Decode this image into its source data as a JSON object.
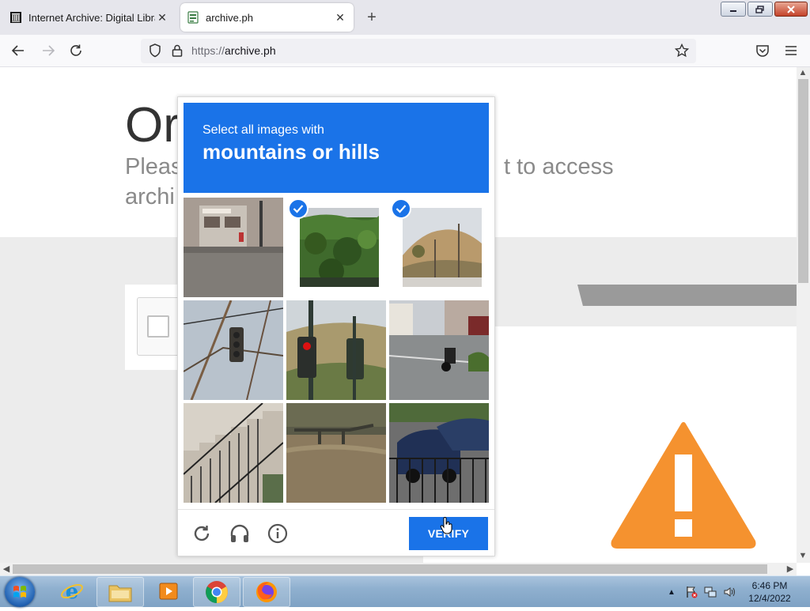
{
  "browser": {
    "tabs": [
      {
        "title": "Internet Archive: Digital Library",
        "active": false
      },
      {
        "title": "archive.ph",
        "active": true
      }
    ],
    "url_protocol": "https://",
    "url_host": "archive.ph"
  },
  "page": {
    "heading_partial": "Or",
    "subtitle_part1": "Pleas",
    "subtitle_part2": "t to access",
    "subtitle_part3": "archi"
  },
  "captcha": {
    "prompt_line1": "Select all images with",
    "prompt_line2": "mountains or hills",
    "tiles": [
      {
        "selected": false,
        "icon": "street-storefront"
      },
      {
        "selected": true,
        "icon": "green-hillside"
      },
      {
        "selected": true,
        "icon": "dry-hill-with-poles"
      },
      {
        "selected": false,
        "icon": "traffic-light-wires"
      },
      {
        "selected": false,
        "icon": "traffic-light-hills"
      },
      {
        "selected": false,
        "icon": "motorcycle-street"
      },
      {
        "selected": false,
        "icon": "staircase-railing"
      },
      {
        "selected": false,
        "icon": "bridge-field"
      },
      {
        "selected": false,
        "icon": "parked-cars-fence"
      }
    ],
    "verify_label": "VERIFY"
  },
  "taskbar": {
    "time": "6:46 PM",
    "date": "12/4/2022"
  },
  "colors": {
    "captcha_blue": "#1a73e8",
    "warning_orange": "#f5922f"
  }
}
